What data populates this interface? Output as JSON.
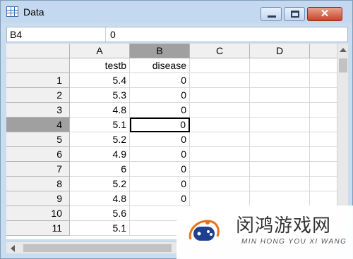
{
  "window": {
    "title": "Data"
  },
  "refbar": {
    "cell_name": "B4",
    "cell_value": "0"
  },
  "grid": {
    "columns": [
      "A",
      "B",
      "C",
      "D"
    ],
    "header_row": [
      "testb",
      "disease",
      "",
      ""
    ],
    "selected_column": "B",
    "selected_row": "4",
    "rows": [
      {
        "num": "1",
        "a": "5.4",
        "b": "0"
      },
      {
        "num": "2",
        "a": "5.3",
        "b": "0"
      },
      {
        "num": "3",
        "a": "4.8",
        "b": "0"
      },
      {
        "num": "4",
        "a": "5.1",
        "b": "0"
      },
      {
        "num": "5",
        "a": "5.2",
        "b": "0"
      },
      {
        "num": "6",
        "a": "4.9",
        "b": "0"
      },
      {
        "num": "7",
        "a": "6",
        "b": "0"
      },
      {
        "num": "8",
        "a": "5.2",
        "b": "0"
      },
      {
        "num": "9",
        "a": "4.8",
        "b": "0"
      },
      {
        "num": "10",
        "a": "5.6",
        "b": ""
      },
      {
        "num": "11",
        "a": "5.1",
        "b": ""
      }
    ]
  },
  "watermark": {
    "title": "闵鸿游戏网",
    "subtitle": "MIN HONG YOU XI WANG"
  },
  "colors": {
    "selection_gray": "#a0a0a0",
    "header_gray": "#f0f0f0",
    "titlebar_blue": "#c4d9ef",
    "close_red": "#c7442a"
  }
}
